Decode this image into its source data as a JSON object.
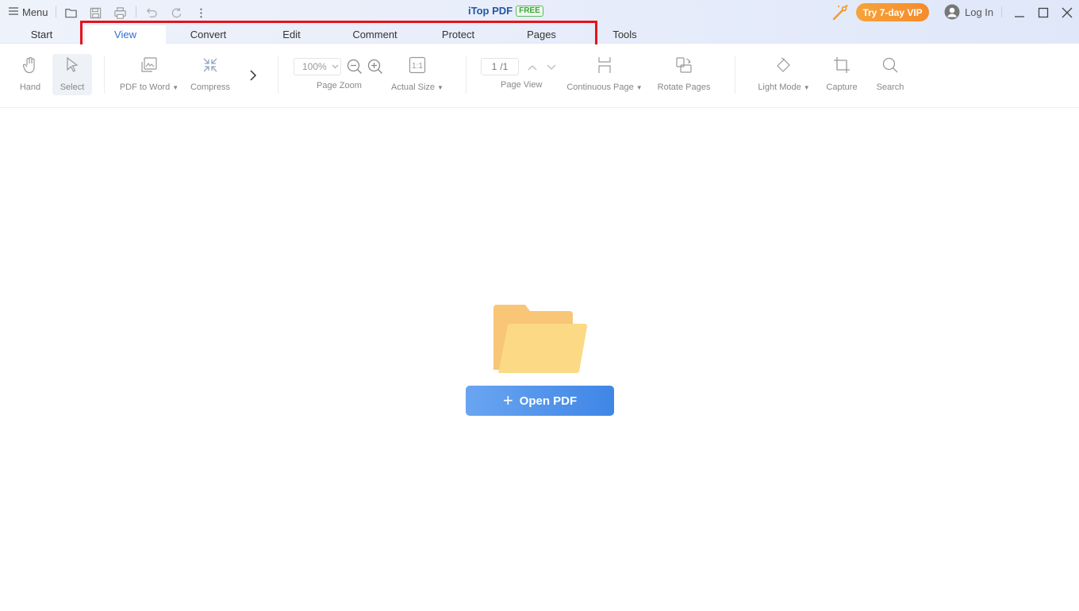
{
  "titlebar": {
    "menu_label": "Menu",
    "app_name": "iTop PDF",
    "app_badge": "FREE",
    "vip_label": "Try 7-day VIP",
    "login_label": "Log In"
  },
  "tabs": [
    {
      "label": "Start"
    },
    {
      "label": "View"
    },
    {
      "label": "Convert"
    },
    {
      "label": "Edit"
    },
    {
      "label": "Comment"
    },
    {
      "label": "Protect"
    },
    {
      "label": "Pages"
    },
    {
      "label": "Tools"
    }
  ],
  "active_tab": "View",
  "toolbar": {
    "hand": "Hand",
    "select": "Select",
    "pdf_to_word": "PDF to Word",
    "compress": "Compress",
    "zoom_value": "100%",
    "page_zoom": "Page Zoom",
    "actual_size": "Actual Size",
    "actual_size_icon": "1:1",
    "page_current": "1",
    "page_total": "/1",
    "page_view": "Page View",
    "continuous_page": "Continuous Page",
    "rotate_pages": "Rotate Pages",
    "light_mode": "Light Mode",
    "capture": "Capture",
    "search": "Search"
  },
  "main": {
    "open_pdf_label": "Open PDF"
  },
  "colors": {
    "accent": "#2c6fd1",
    "vip_orange": "#f7a33a",
    "highlight_red": "#e4141b",
    "folder_yellow": "#fbd985"
  }
}
